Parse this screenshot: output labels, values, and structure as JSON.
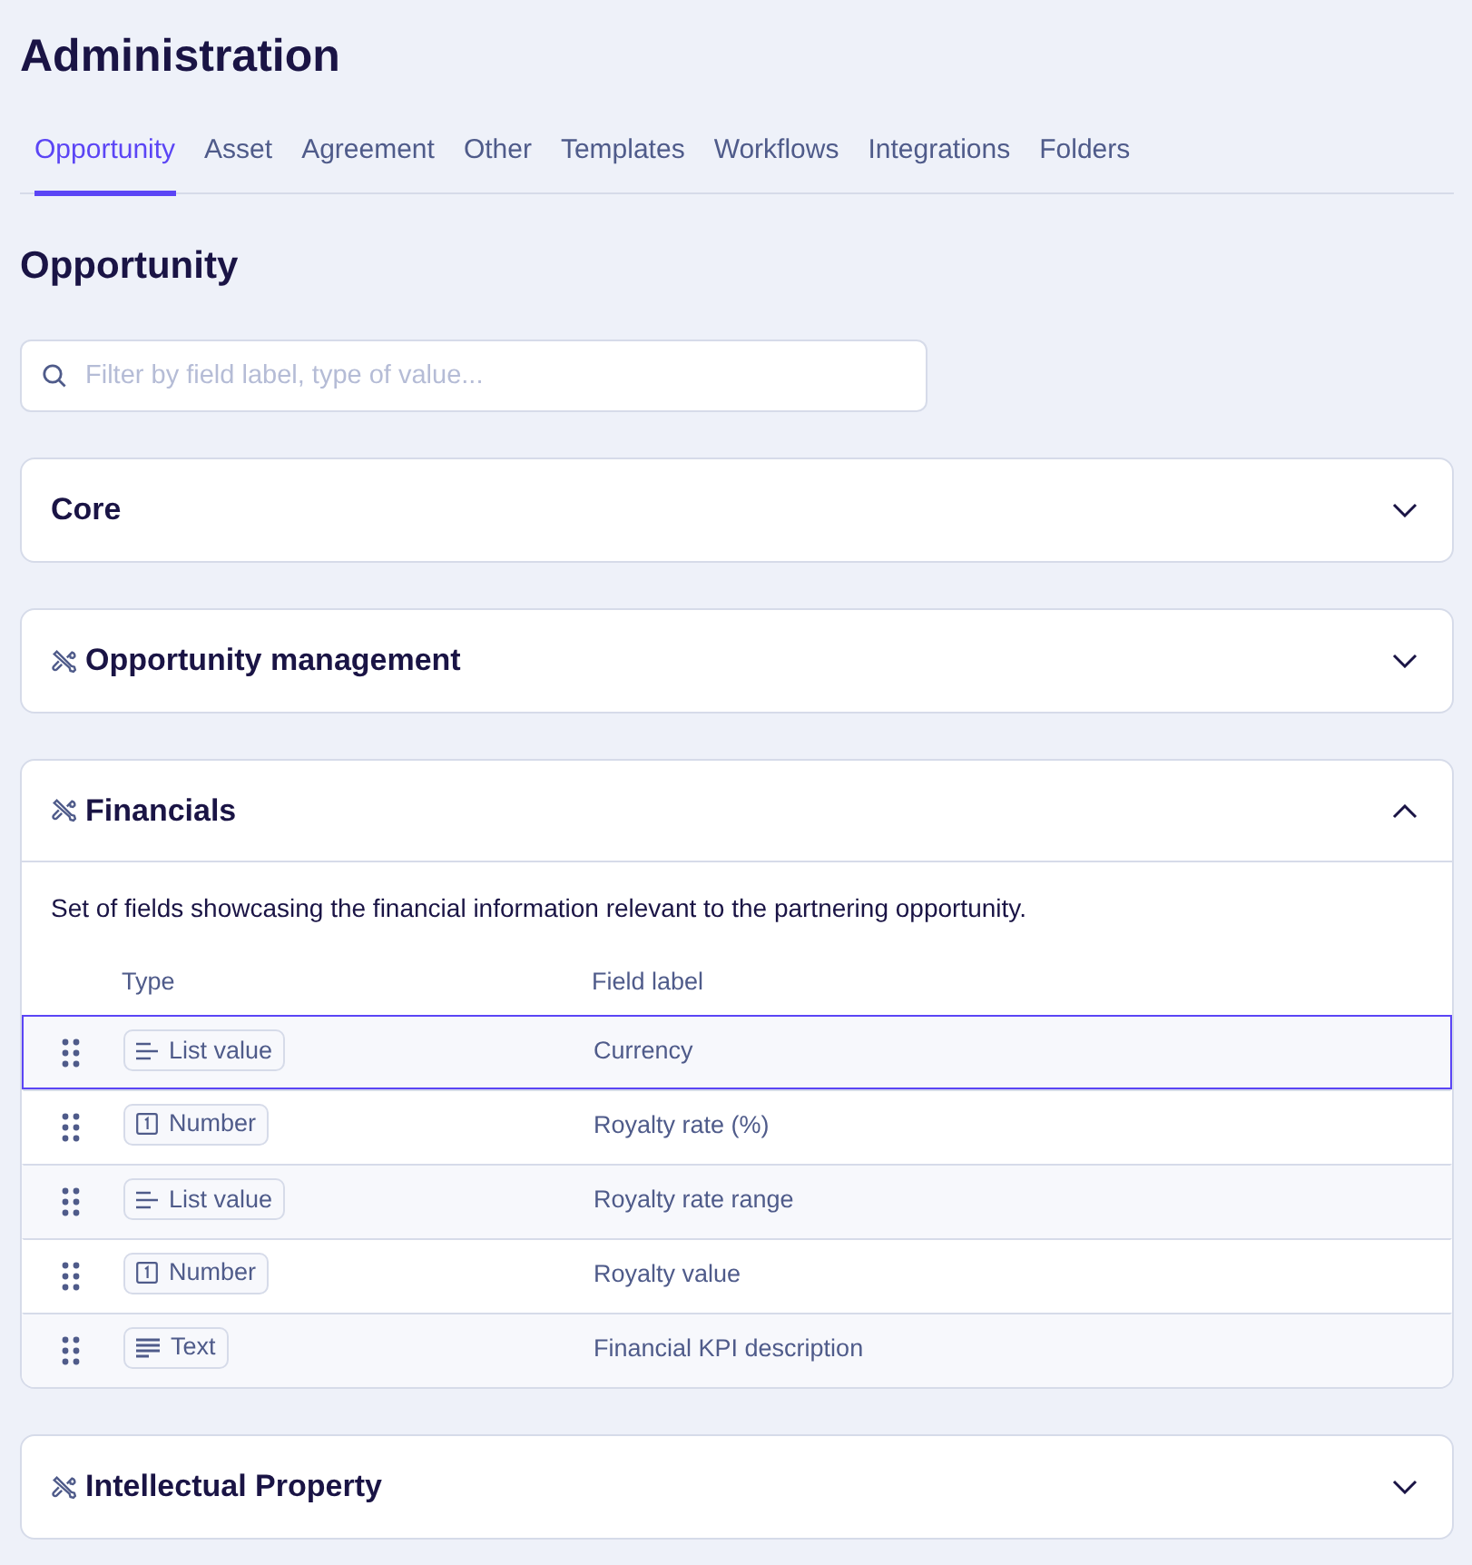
{
  "page_title": "Administration",
  "tabs": [
    {
      "label": "Opportunity",
      "selected": true
    },
    {
      "label": "Asset",
      "selected": false
    },
    {
      "label": "Agreement",
      "selected": false
    },
    {
      "label": "Other",
      "selected": false
    },
    {
      "label": "Templates",
      "selected": false
    },
    {
      "label": "Workflows",
      "selected": false
    },
    {
      "label": "Integrations",
      "selected": false
    },
    {
      "label": "Folders",
      "selected": false
    }
  ],
  "section_title": "Opportunity",
  "search": {
    "placeholder": "Filter by field label, type of value..."
  },
  "groups": [
    {
      "kind": "standard",
      "title": "Core",
      "expanded": false
    },
    {
      "kind": "custom",
      "title": "Opportunity management",
      "expanded": false
    },
    {
      "kind": "custom",
      "title": "Financials",
      "expanded": true,
      "description": "Set of fields showcasing the financial information relevant to the partnering opportunity.",
      "columns": [
        "Type",
        "Field label"
      ],
      "rows": [
        {
          "kind": "list",
          "type": "List value",
          "label": "Currency",
          "selected": true
        },
        {
          "kind": "number",
          "type": "Number",
          "label": "Royalty rate (%)",
          "selected": false
        },
        {
          "kind": "list",
          "type": "List value",
          "label": "Royalty rate range",
          "selected": false
        },
        {
          "kind": "number",
          "type": "Number",
          "label": "Royalty value",
          "selected": false
        },
        {
          "kind": "text",
          "type": "Text",
          "label": "Financial KPI description",
          "selected": false
        }
      ]
    },
    {
      "kind": "custom",
      "title": "Intellectual Property",
      "expanded": false
    }
  ]
}
